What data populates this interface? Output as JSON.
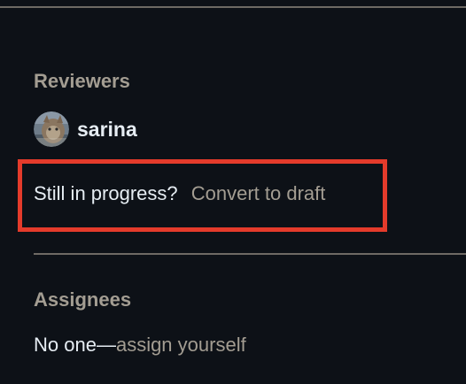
{
  "reviewers": {
    "heading": "Reviewers",
    "items": [
      {
        "name": "sarina"
      }
    ]
  },
  "draft": {
    "question": "Still in progress?",
    "link_label": "Convert to draft"
  },
  "assignees": {
    "heading": "Assignees",
    "none_label": "No one—",
    "assign_self_label": "assign yourself"
  },
  "colors": {
    "background": "#0d1117",
    "primary_text": "#e6edf3",
    "muted_text": "#a39d92",
    "divider": "#6e6a64",
    "highlight_border": "#e43b2b"
  }
}
